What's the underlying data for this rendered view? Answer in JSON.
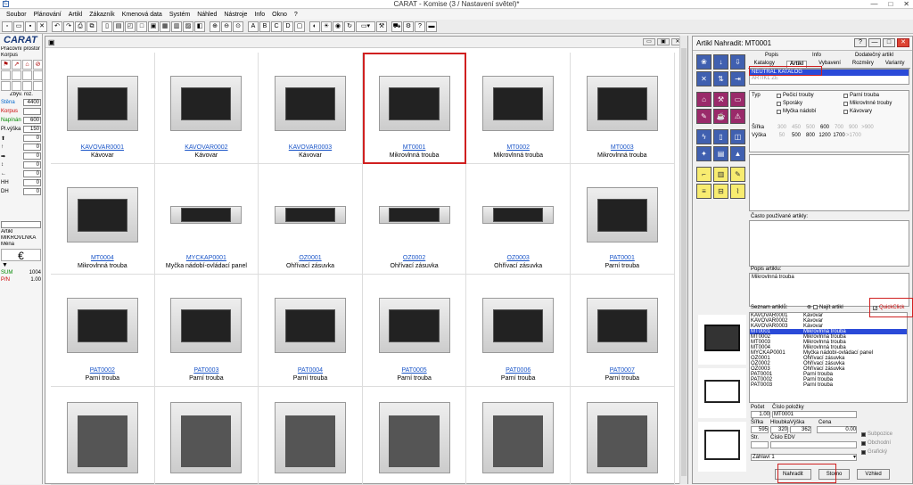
{
  "title": "CARAT - Komise (3 / Nastavení světel)*",
  "menu": [
    "Soubor",
    "Plánování",
    "Artikl",
    "Zákazník",
    "Kmenová data",
    "Systém",
    "Náhled",
    "Nástroje",
    "Info",
    "Okno",
    "?"
  ],
  "left": {
    "logo": "CARAT",
    "workspace": "Pracovní prostor",
    "korpus": "Korpus",
    "zbyv": "Zbýv. roz.",
    "rows": [
      {
        "l": "Stěna",
        "v": "4400"
      },
      {
        "l": "Korpus",
        "v": ""
      },
      {
        "l": "Napínán",
        "v": "600"
      },
      {
        "l": "Pl.výška",
        "v": "150"
      }
    ],
    "small_vals": [
      "0",
      "0",
      "0",
      "0",
      "0",
      "0",
      "0"
    ],
    "small_labels": [
      "HH",
      "DH"
    ],
    "artikl": "Artikl",
    "mikro": "MIKROVLNKA",
    "mena": "Měna",
    "currency": "€",
    "sum": "SUM",
    "sum_v": "1004",
    "pn": "P/N",
    "pn_v": "1.00"
  },
  "grid": [
    {
      "code": "KAVOVAR0001",
      "name": "Kávovar"
    },
    {
      "code": "KAVOVAR0002",
      "name": "Kávovar"
    },
    {
      "code": "KAVOVAR0003",
      "name": "Kávovar"
    },
    {
      "code": "MT0001",
      "name": "Mikrovlnná trouba"
    },
    {
      "code": "MT0002",
      "name": "Mikrovlnná trouba"
    },
    {
      "code": "MT0003",
      "name": "Mikrovlnná trouba"
    },
    {
      "code": "MT0004",
      "name": "Mikrovlnná trouba"
    },
    {
      "code": "MYCKAP0001",
      "name": "Myčka nádobí-ovládací panel"
    },
    {
      "code": "OZ0001",
      "name": "Ohřívací zásuvka"
    },
    {
      "code": "OZ0002",
      "name": "Ohřívací zásuvka"
    },
    {
      "code": "OZ0003",
      "name": "Ohřívací zásuvka"
    },
    {
      "code": "PAT0001",
      "name": "Parní trouba"
    },
    {
      "code": "PAT0002",
      "name": "Parní trouba"
    },
    {
      "code": "PAT0003",
      "name": "Parní trouba"
    },
    {
      "code": "PAT0004",
      "name": "Parní trouba"
    },
    {
      "code": "PAT0005",
      "name": "Parní trouba"
    },
    {
      "code": "PAT0006",
      "name": "Parní trouba"
    },
    {
      "code": "PAT0007",
      "name": "Parní trouba"
    },
    {
      "code": "",
      "name": ""
    },
    {
      "code": "",
      "name": ""
    },
    {
      "code": "",
      "name": ""
    },
    {
      "code": "",
      "name": ""
    },
    {
      "code": "",
      "name": ""
    },
    {
      "code": "",
      "name": ""
    }
  ],
  "right": {
    "title": "Artikl Nahradit: MT0001",
    "tabs1": [
      "Popis",
      "Info",
      "Dodatečný artikl"
    ],
    "tabs2": [
      "Katalogy",
      "Artikl",
      "Vybavení",
      "Rozměry",
      "Varianty"
    ],
    "catalog1": "NEUTRAL KATALOG",
    "catalog2": "ARTIKL ZE",
    "typ": "Typ",
    "checks": [
      "Pečicí trouby",
      "Parní trouba",
      "Sporáky",
      "Mikrovlnné trouby",
      "Myčka nádobí",
      "Kávovary"
    ],
    "sirka": "Šířka",
    "vyska": "Výška",
    "sirka_vals": [
      "300",
      "450",
      "500",
      "600",
      "700",
      "900",
      ">900"
    ],
    "vyska_vals": [
      "50",
      "500",
      "800",
      "1200",
      "1700",
      ">1700"
    ],
    "freq": "Často používané artikly:",
    "desc_label": "Popis artiklu:",
    "desc": "Mikrovlnná trouba",
    "seznam": "Seznam artiklů:",
    "najit": "Najít artikl",
    "quick": "QuickClick",
    "list": [
      [
        "KAVOVAR0001",
        "Kávovar"
      ],
      [
        "KAVOVAR0002",
        "Kávovar"
      ],
      [
        "KAVOVAR0003",
        "Kávovar"
      ],
      [
        "MT0001",
        "Mikrovlnná trouba"
      ],
      [
        "MT0002",
        "Mikrovlnná trouba"
      ],
      [
        "MT0003",
        "Mikrovlnná trouba"
      ],
      [
        "MT0004",
        "Mikrovlnná trouba"
      ],
      [
        "MYCKAP0001",
        "Myčka nádobí-ovládací panel"
      ],
      [
        "OZ0001",
        "Ohřívací zásuvka"
      ],
      [
        "OZ0002",
        "Ohřívací zásuvka"
      ],
      [
        "OZ0003",
        "Ohřívací zásuvka"
      ],
      [
        "PAT0001",
        "Parní trouba"
      ],
      [
        "PAT0002",
        "Parní trouba"
      ],
      [
        "PAT0003",
        "Parní trouba"
      ]
    ],
    "pocet": "Počet",
    "cislo": "Číslo položky",
    "pocet_v": "1.00",
    "cislo_v": "MT0001",
    "sirka2": "Šířka",
    "hloubka": "Hloubka",
    "vyska2": "Výška",
    "cena": "Cena",
    "sirka2_v": "595",
    "hloubka_v": "320",
    "vyska2_v": "362",
    "cena_v": "0.00",
    "str": "Str.",
    "edv": "Číslo EDV",
    "zahlavi": "Záhlaví 1",
    "opts": [
      "Subpozice",
      "Obchodní",
      "Grafický"
    ],
    "btn_nahradit": "Nahradit",
    "btn_storno": "Storno",
    "btn_vzhled": "Vzhled"
  }
}
